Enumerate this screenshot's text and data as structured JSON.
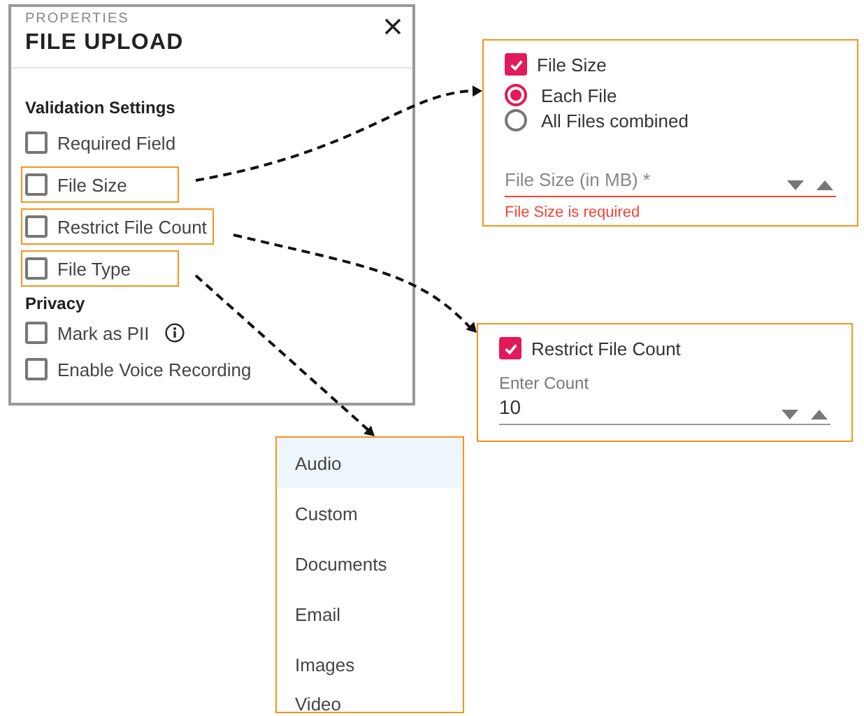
{
  "properties_panel": {
    "eyebrow": "PROPERTIES",
    "title": "FILE UPLOAD",
    "sections": [
      {
        "heading": "Validation Settings",
        "options": [
          {
            "label": "Required Field",
            "checked": false,
            "highlighted": false,
            "info": false
          },
          {
            "label": "File Size",
            "checked": false,
            "highlighted": true,
            "info": false
          },
          {
            "label": "Restrict File Count",
            "checked": false,
            "highlighted": true,
            "info": false
          },
          {
            "label": "File Type",
            "checked": false,
            "highlighted": true,
            "info": false
          }
        ]
      },
      {
        "heading": "Privacy",
        "options": [
          {
            "label": "Mark as PII",
            "checked": false,
            "highlighted": false,
            "info": true
          },
          {
            "label": "Enable Voice Recording",
            "checked": false,
            "highlighted": false,
            "info": false
          }
        ]
      }
    ]
  },
  "file_size_panel": {
    "checkbox": {
      "label": "File Size",
      "checked": true
    },
    "radios": [
      {
        "label": "Each File",
        "selected": true
      },
      {
        "label": "All Files combined",
        "selected": false
      }
    ],
    "field": {
      "placeholder": "File Size (in MB) *",
      "invalid": true
    },
    "error": "File Size is required"
  },
  "count_panel": {
    "checkbox": {
      "label": "Restrict File Count",
      "checked": true
    },
    "field": {
      "label": "Enter Count",
      "value": "10",
      "invalid": false
    }
  },
  "file_type_menu": {
    "options": [
      {
        "label": "Audio",
        "selected": true
      },
      {
        "label": "Custom",
        "selected": false
      },
      {
        "label": "Documents",
        "selected": false
      },
      {
        "label": "Email",
        "selected": false
      },
      {
        "label": "Images",
        "selected": false
      },
      {
        "label": "Video",
        "selected": false
      }
    ]
  }
}
